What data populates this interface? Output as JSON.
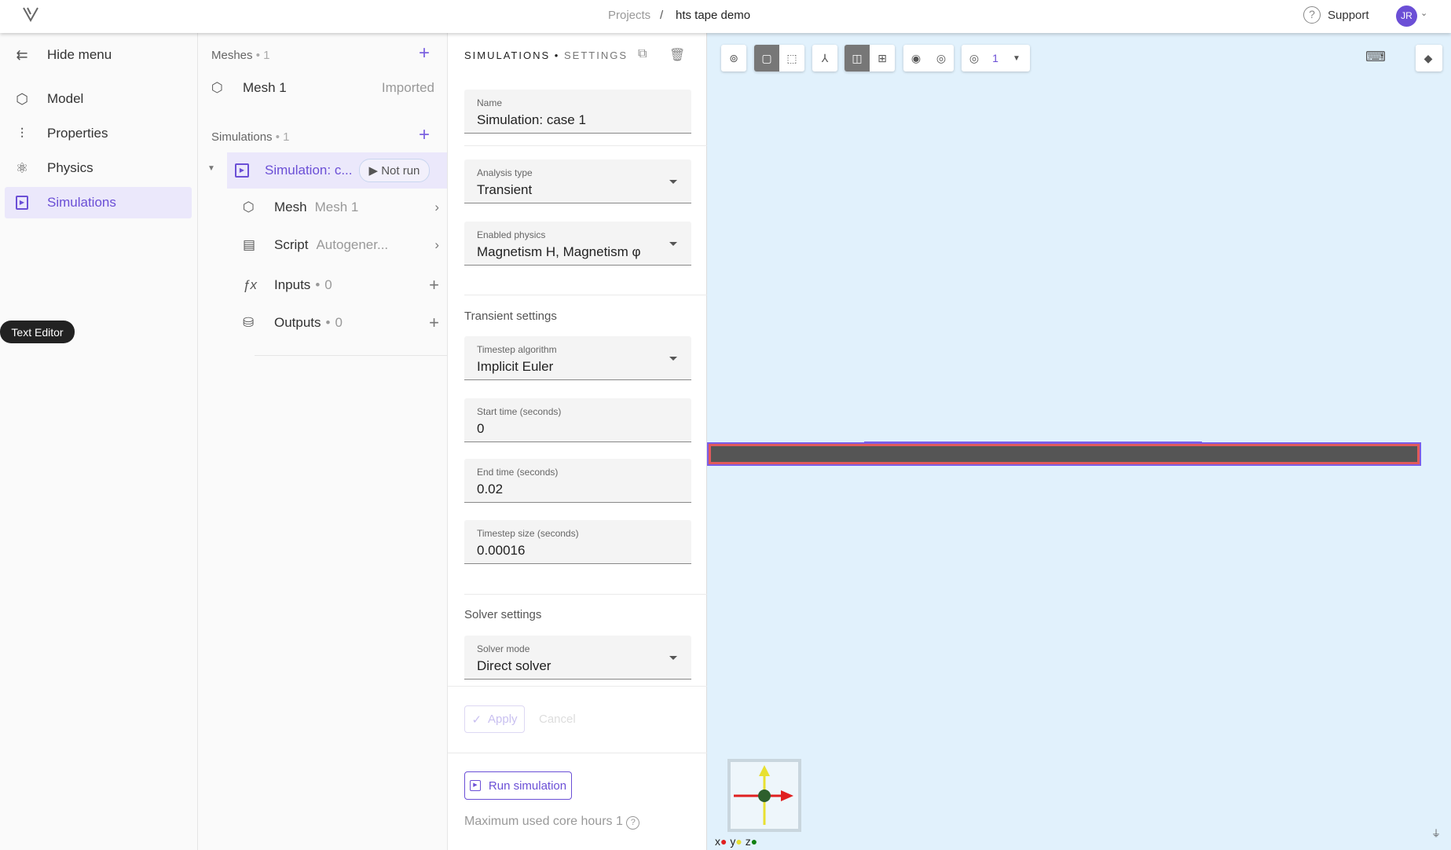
{
  "header": {
    "breadcrumb": [
      "Projects",
      "hts tape demo"
    ],
    "separator": "/",
    "support": "Support",
    "avatar": "JR"
  },
  "nav": {
    "hide_menu": "Hide menu",
    "items": [
      {
        "label": "Model",
        "icon": "cube-icon"
      },
      {
        "label": "Properties",
        "icon": "sliders-icon"
      },
      {
        "label": "Physics",
        "icon": "atom-icon"
      },
      {
        "label": "Simulations",
        "icon": "play-square-icon",
        "active": true
      }
    ],
    "tooltip": "Text Editor"
  },
  "tree": {
    "meshes_title": "Meshes",
    "meshes_count": "1",
    "mesh": {
      "label": "Mesh 1",
      "status": "Imported"
    },
    "simulations_title": "Simulations",
    "simulations_count": "1",
    "simulation": {
      "label": "Simulation: c...",
      "status": "Not run"
    },
    "children": [
      {
        "label": "Mesh",
        "detail": "Mesh 1"
      },
      {
        "label": "Script",
        "detail": "Autogener..."
      },
      {
        "label": "Inputs",
        "count": "0"
      },
      {
        "label": "Outputs",
        "count": "0"
      }
    ]
  },
  "settings": {
    "title": "SIMULATIONS",
    "subtitle": "SETTINGS",
    "name": {
      "label": "Name",
      "value": "Simulation: case 1"
    },
    "analysis": {
      "label": "Analysis type",
      "value": "Transient"
    },
    "physics": {
      "label": "Enabled physics",
      "value": "Magnetism H, Magnetism φ"
    },
    "transient_title": "Transient settings",
    "timestep_alg": {
      "label": "Timestep algorithm",
      "value": "Implicit Euler"
    },
    "start": {
      "label": "Start time (seconds)",
      "value": "0"
    },
    "end": {
      "label": "End time (seconds)",
      "value": "0.02"
    },
    "step": {
      "label": "Timestep size (seconds)",
      "value": "0.00016"
    },
    "solver_title": "Solver settings",
    "solver": {
      "label": "Solver mode",
      "value": "Direct solver"
    },
    "apply": "Apply",
    "cancel": "Cancel",
    "run": "Run simulation",
    "core_hours": "Maximum used core hours 1"
  },
  "viewport": {
    "view_count": "1",
    "axes": [
      "x",
      "y",
      "z"
    ],
    "axis_colors": {
      "x": "#e02020",
      "y": "#e8e030",
      "z": "#108010"
    },
    "accent": "#6b4fd6"
  }
}
